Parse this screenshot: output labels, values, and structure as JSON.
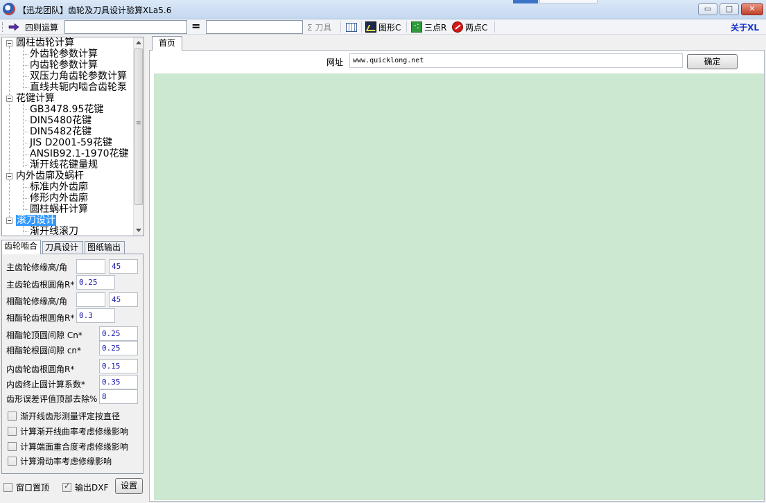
{
  "window": {
    "title": "【迅龙团队】齿轮及刀具设计验算XLa5.6",
    "min_glyph": "▭",
    "max_glyph": "□",
    "close_glyph": "✕"
  },
  "toolbar": {
    "calc_label": "四则运算",
    "expr_value": "",
    "equals": "=",
    "result_value": "",
    "tool_label": "Σ 刀具",
    "graph_label": "图形C",
    "three_point_label": "三点R",
    "two_point_label": "两点C",
    "about_label": "关于XL"
  },
  "tree": {
    "groups": [
      {
        "label": "圆柱齿轮计算",
        "children": [
          "外齿轮参数计算",
          "内齿轮参数计算",
          "双压力角齿轮参数计算",
          "直线共轭内啮合齿轮泵"
        ]
      },
      {
        "label": "花键计算",
        "children": [
          "GB3478.95花键",
          "DIN5480花键",
          "DIN5482花键",
          "JIS D2001-59花键",
          "ANSIB92.1-1970花键",
          "渐开线花键量规"
        ]
      },
      {
        "label": "内外齿廓及蜗杆",
        "children": [
          "标准内外齿廓",
          "修形内外齿廓",
          "圆柱蜗杆计算"
        ]
      },
      {
        "label": "滚刀设计",
        "children": [
          "渐开线滚刀"
        ]
      }
    ]
  },
  "left_tabs": [
    "齿轮啮合",
    "刀具设计",
    "图纸输出"
  ],
  "params": {
    "main_tip": {
      "label": "主齿轮修缘高/角",
      "value1": "",
      "value2": "45"
    },
    "main_root": {
      "label": "主齿轮齿根圆角R*",
      "value": "0.25"
    },
    "mate_tip": {
      "label": "相酯轮修缘高/角",
      "value1": "",
      "value2": "45"
    },
    "mate_root": {
      "label": "相酯轮齿根圆角R*",
      "value": "0.3"
    },
    "tip_clear": {
      "label": "相酯轮顶圆间隙  Cn*",
      "value": "0.25"
    },
    "root_clear": {
      "label": "相酯轮根圆间隙  cn*",
      "value": "0.25"
    },
    "inner_root": {
      "label": "内齿轮齿根圆角R*",
      "value": "0.15"
    },
    "inner_stop": {
      "label": "内齿终止圆计算系数*",
      "value": "0.35"
    },
    "profile_err": {
      "label": "齿形误差评值顶部去除%",
      "value": "8"
    }
  },
  "checkboxes": [
    {
      "label": "渐开线齿形测量评定按直径",
      "checked": false
    },
    {
      "label": "计算渐开线曲率考虑修缘影响",
      "checked": false
    },
    {
      "label": "计算端面重合度考虑修缘影响",
      "checked": false
    },
    {
      "label": "计算滑动率考虑修缘影响",
      "checked": false
    }
  ],
  "bottom": {
    "topmost_label": "窗口置顶",
    "topmost_checked": false,
    "dxf_label": "输出DXF",
    "dxf_checked": true,
    "settings_label": "设置"
  },
  "main": {
    "tab_label": "首页",
    "url_label": "网址",
    "url_value": "www.quicklong.net",
    "ok_label": "确定"
  },
  "colors": {
    "browser_bg": "#cde8d0",
    "selection": "#3399ff",
    "about": "#1530c8"
  }
}
